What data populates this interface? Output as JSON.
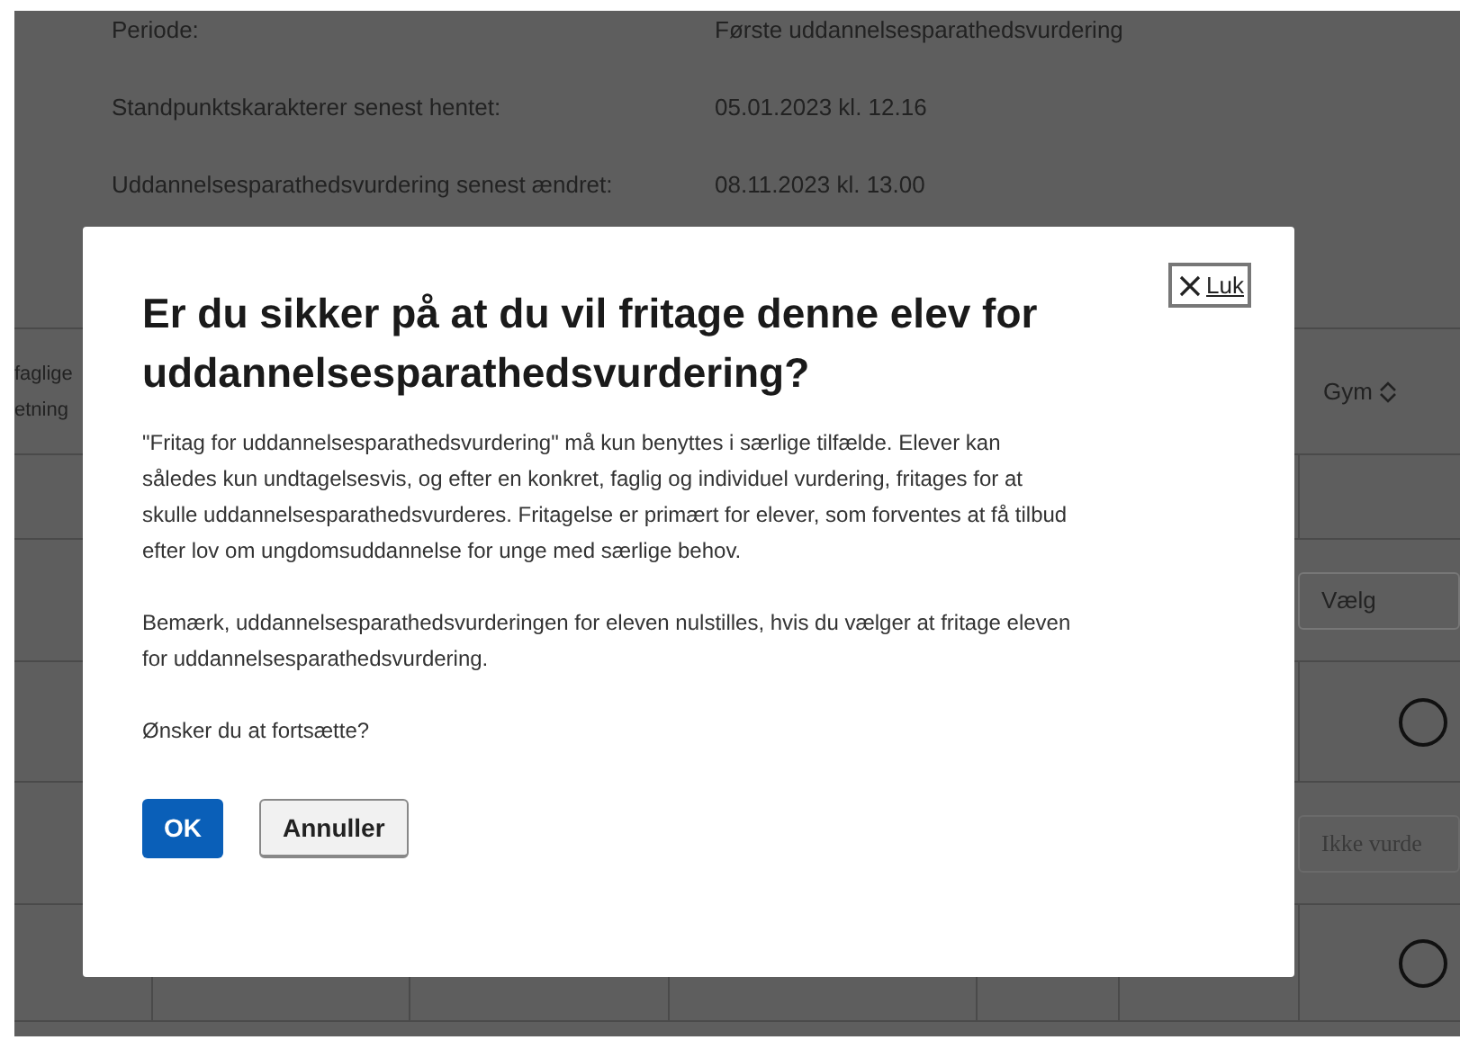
{
  "info_rows": [
    {
      "label": "Periode:",
      "value": "Første uddannelsesparathedsvurdering"
    },
    {
      "label": "Standpunktskarakterer senest hentet:",
      "value": "05.01.2023 kl. 12.16"
    },
    {
      "label": "Uddannelsesparathedsvurdering senest ændret:",
      "value": "08.11.2023 kl. 13.00"
    }
  ],
  "table": {
    "columns": [
      {
        "label": "faglige etning"
      },
      {
        "label": "Gym",
        "sortable": true
      }
    ],
    "rows": [
      {
        "kind": "empty"
      },
      {
        "kind": "select",
        "placeholder": "Vælg"
      },
      {
        "kind": "radio",
        "checked": false
      },
      {
        "kind": "field",
        "placeholder": "Ikke vurde"
      },
      {
        "kind": "radio",
        "checked": false
      }
    ]
  },
  "dialog": {
    "close_label": "Luk",
    "title": "Er du sikker på at du vil fritage denne elev for uddannelsesparathedsvurdering?",
    "paragraphs": [
      "\"Fritag for uddannelsesparathedsvurdering\" må kun benyttes i særlige tilfælde. Elever kan således kun undtagelsesvis, og efter en konkret, faglig og individuel vurdering, fritages for at skulle uddannelsesparathedsvurderes. Fritagelse er primært for elever, som forventes at få tilbud efter lov om ungdomsuddannelse for unge med særlige behov.",
      "Bemærk, uddannelsesparathedsvurderingen for eleven nulstilles, hvis du vælger at fritage eleven for uddannelsesparathedsvurdering.",
      "Ønsker du at fortsætte?"
    ],
    "buttons": [
      {
        "label": "OK",
        "kind": "primary"
      },
      {
        "label": "Annuller",
        "kind": "secondary"
      }
    ]
  }
}
